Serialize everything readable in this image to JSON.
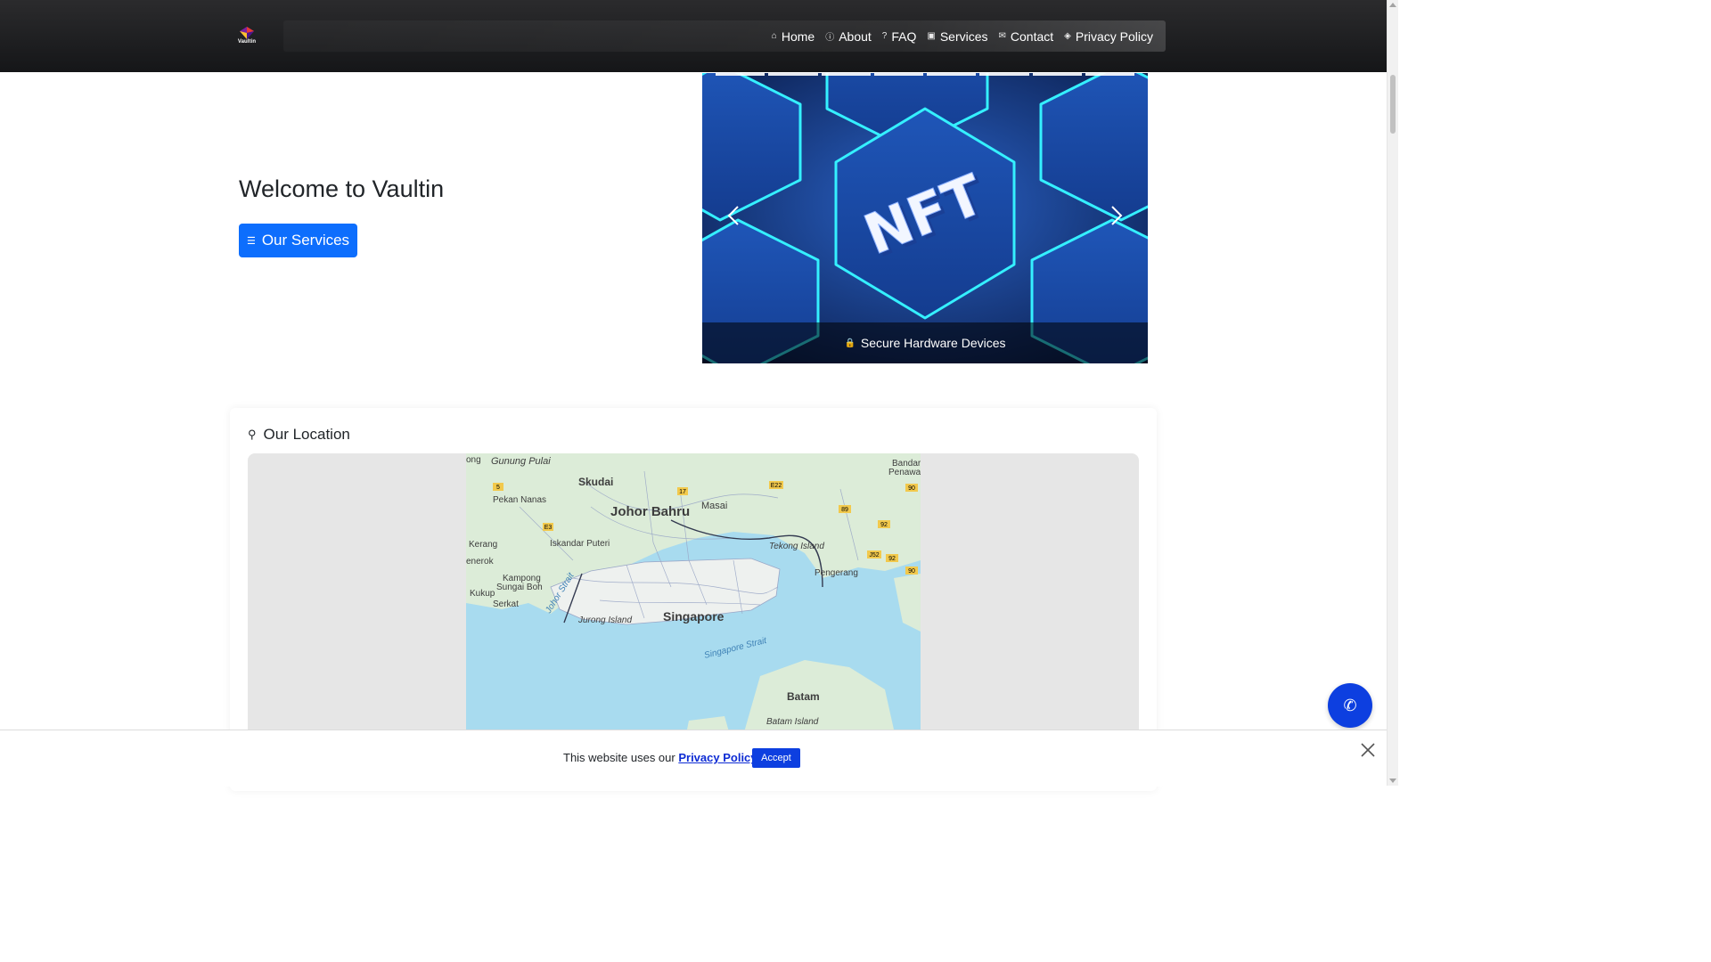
{
  "brand": {
    "name": "Vaultin"
  },
  "nav": {
    "items": [
      {
        "label": "Home",
        "icon": "home-icon"
      },
      {
        "label": "About",
        "icon": "info-icon"
      },
      {
        "label": "FAQ",
        "icon": "question-icon"
      },
      {
        "label": "Services",
        "icon": "briefcase-icon"
      },
      {
        "label": "Contact",
        "icon": "envelope-icon"
      },
      {
        "label": "Privacy Policy",
        "icon": "shield-icon"
      }
    ]
  },
  "hero": {
    "title": "Welcome to Vaultin",
    "button_label": "Our Services",
    "button_icon": "list-icon"
  },
  "carousel": {
    "image_text": "NFT",
    "caption": "Secure Hardware Devices",
    "caption_icon": "lock-icon",
    "slide_count": 8
  },
  "location": {
    "title": "Our Location",
    "title_icon": "map-marker-icon",
    "map_labels": {
      "gunung_pulai": "Gunung Pulai",
      "skudai": "Skudai",
      "johor_bahru": "Johor Bahru",
      "masai": "Masai",
      "pekan_nanas": "Pekan Nanas",
      "iskandar_puteri": "Iskandar Puteri",
      "kerang": "Kerang",
      "tekong_island": "Tekong Island",
      "pengerang": "Pengerang",
      "kampong_sungai_boh_1": "Kampong",
      "kampong_sungai_boh_2": "Sungai Boh",
      "kukup": "Kukup",
      "serkat": "Serkat",
      "johor_strait": "Johor Strait",
      "jurong_island": "Jurong Island",
      "singapore": "Singapore",
      "singapore_strait": "Singapore Strait",
      "batam": "Batam",
      "batam_island": "Batam Island",
      "bandar_penawar_1": "Bandar",
      "bandar_penawar_2": "Penawa",
      "nerok": "enerok",
      "ong": "ong"
    },
    "road_badges": [
      "5",
      "17",
      "E22",
      "90",
      "89",
      "E3",
      "92",
      "J52",
      "92",
      "90"
    ]
  },
  "cookie": {
    "text_before": "This website uses our ",
    "link": "Privacy Policy",
    "text_after": ".",
    "accept_label": "Accept"
  },
  "colors": {
    "primary": "#0d6efd",
    "accent_dark": "#0d3fe0",
    "navbar": "#1c1d1f"
  }
}
